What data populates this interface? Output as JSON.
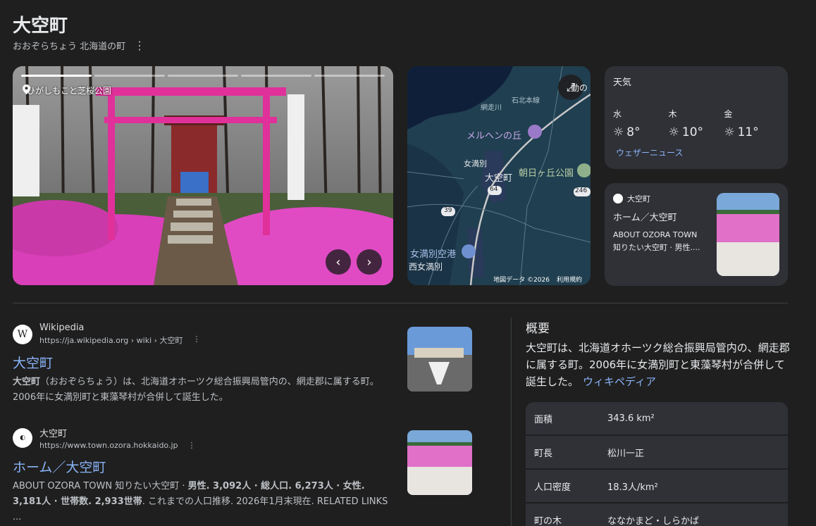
{
  "header": {
    "title": "大空町",
    "subtitle": "おおぞらちょう 北海道の町"
  },
  "hero": {
    "place": "ひがしもこと芝桜公園",
    "prev": "‹",
    "next": "›"
  },
  "map": {
    "labels": [
      "メルヘンの丘",
      "女満別",
      "大空町",
      "朝日ヶ丘公園",
      "女満別空港",
      "西女満別",
      "網走川",
      "石北本線",
      "動の"
    ],
    "routes": [
      "64",
      "39",
      "246"
    ],
    "footer_data": "地図データ ©2026",
    "footer_terms": "利用規約"
  },
  "weather": {
    "title": "天気",
    "days": [
      {
        "name": "水",
        "temp": "8°"
      },
      {
        "name": "木",
        "temp": "10°"
      },
      {
        "name": "金",
        "temp": "11°"
      }
    ],
    "news": "ウェザーニュース"
  },
  "site_card": {
    "name": "大空町",
    "title": "ホーム／大空町",
    "snippet1": "ABOUT OZORA TOWN",
    "snippet2": "知りたい大空町 · 男性...."
  },
  "results": [
    {
      "site": "Wikipedia",
      "url": "https://ja.wikipedia.org › wiki › 大空町",
      "title": "大空町",
      "snippet_bold": "大空町",
      "snippet": "（おおぞらちょう）は、北海道オホーツク総合振興局管内の、網走郡に属する町。2006年に女満別町と東藻琴村が合併して誕生した。"
    },
    {
      "site": "大空町",
      "url": "https://www.town.ozora.hokkaido.jp",
      "title": "ホーム／大空町",
      "snippet_a": "ABOUT OZORA TOWN 知りたい大空町 · ",
      "snippet_b": "男性. 3,092人 · 総人口. 6,273人 · 女性. 3,181人 · 世帯数. 2,933世帯",
      "snippet_c": ". これまでの人口推移. 2026年1月末現在. RELATED LINKS ..."
    }
  ],
  "overview": {
    "title": "概要",
    "text": "大空町は、北海道オホーツク総合振興局管内の、網走郡に属する町。2006年に女満別町と東藻琴村が合併して誕生した。",
    "link": "ウィキペディア",
    "facts": [
      {
        "key": "面積",
        "value": "343.6 km²"
      },
      {
        "key": "町長",
        "value": "松川一正"
      },
      {
        "key": "人口密度",
        "value": "18.3人/km²"
      },
      {
        "key": "町の木",
        "value": "ななかまど・しらかば"
      }
    ]
  }
}
